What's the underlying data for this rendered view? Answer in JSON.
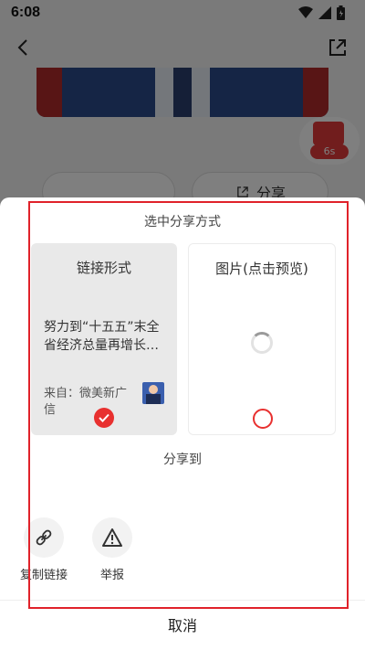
{
  "status_bar": {
    "time": "6:08"
  },
  "background": {
    "gift_timer": "6s",
    "share_pill_label": "分享"
  },
  "sheet": {
    "title": "选中分享方式",
    "link_card": {
      "title": "链接形式",
      "headline": "努力到“十五五”末全省经济总量再增长…",
      "source": "来自：微美新广信",
      "selected": true
    },
    "image_card": {
      "title": "图片(点击预览)",
      "selected": false
    },
    "share_to_label": "分享到",
    "actions": [
      {
        "label": "复制链接",
        "icon": "link-icon"
      },
      {
        "label": "举报",
        "icon": "warning-icon"
      }
    ],
    "cancel_label": "取消"
  },
  "colors": {
    "accent": "#e8302f",
    "overlay": "rgba(0,0,0,0.5)",
    "annotation": "#e0222a"
  }
}
